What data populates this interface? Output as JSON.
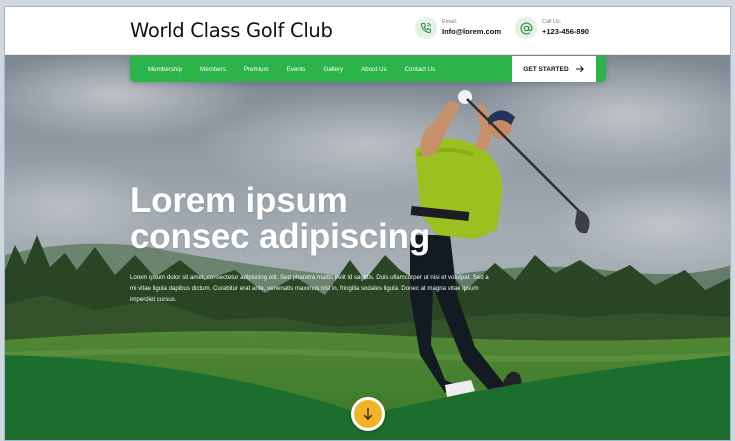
{
  "header": {
    "logo_text": "World Class Golf Club",
    "email": {
      "label": "Email:",
      "value": "Info@lorem.com",
      "icon": "phone-icon"
    },
    "phone": {
      "label": "Call Us:",
      "value": "+123-456-890",
      "icon": "at-sign-icon"
    }
  },
  "nav": {
    "items": [
      "Membership",
      "Members",
      "Premium",
      "Events",
      "Gallery",
      "About Us",
      "Contact Us"
    ],
    "cta_label": "GET STARTED"
  },
  "hero": {
    "headline_line1": "Lorem ipsum",
    "headline_line2": "consec adipiscing",
    "paragraph": "Lorem ipsum dolor sit amet, consectetur adipiscing elit. Sed pharetra mattis velit id sagittis. Duis ullamcorper ut nisi et volutpat. Sed a mi vitae ligula dapibus dictum. Curabitur erat ante, venenatis maximus nisl in, fringilla sodales ligula. Donec at magna vitae ipsum imperdiet cursus."
  },
  "colors": {
    "brand_green": "#2cb34a",
    "dark_green": "#1c6e2e",
    "accent_yellow": "#f2b32a"
  },
  "scroll_button_icon": "arrow-down-icon"
}
